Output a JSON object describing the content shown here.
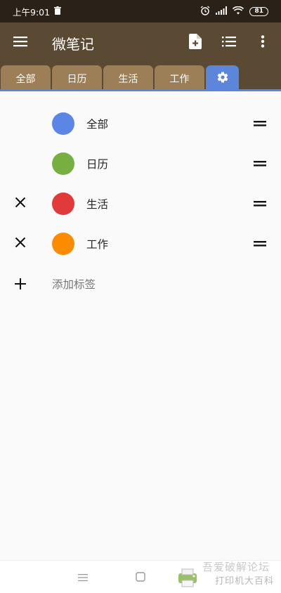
{
  "status": {
    "time": "上午9:01",
    "battery": "81"
  },
  "app": {
    "title": "微笔记"
  },
  "tabs": [
    {
      "label": "全部"
    },
    {
      "label": "日历"
    },
    {
      "label": "生活"
    },
    {
      "label": "工作"
    }
  ],
  "labels": [
    {
      "name": "全部",
      "color": "#5b86e5",
      "removable": false
    },
    {
      "name": "日历",
      "color": "#77b041",
      "removable": false
    },
    {
      "name": "生活",
      "color": "#e2393a",
      "removable": true
    },
    {
      "name": "工作",
      "color": "#fb8c00",
      "removable": true
    }
  ],
  "add_label": "添加标签",
  "watermark": {
    "line1": "吾爱破解论坛",
    "line2": "打印机大百科"
  }
}
